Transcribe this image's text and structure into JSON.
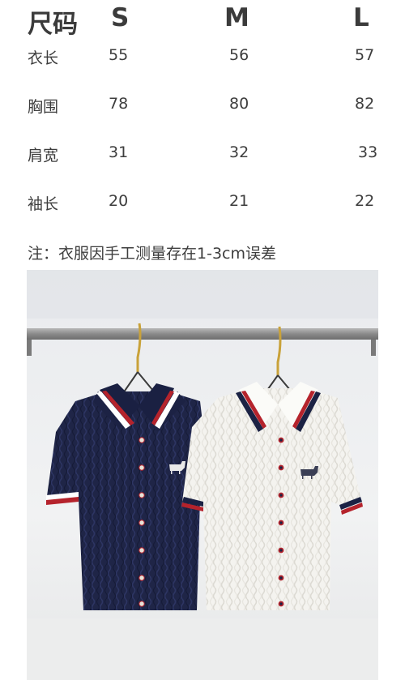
{
  "table": {
    "title": "尺码",
    "sizes": [
      "S",
      "M",
      "L"
    ],
    "rows": [
      {
        "label": "衣长",
        "values": [
          "55",
          "56",
          "57"
        ]
      },
      {
        "label": "胸围",
        "values": [
          "78",
          "80",
          "82"
        ]
      },
      {
        "label": "肩宽",
        "values": [
          "31",
          "32",
          "33"
        ]
      },
      {
        "label": "袖长",
        "values": [
          "20",
          "21",
          "22"
        ]
      }
    ]
  },
  "note": "注：衣服因手工测量存在1-3cm误差",
  "photo": {
    "items": [
      "navy-knit-polo-cardigan",
      "white-knit-polo-cardigan"
    ],
    "colors": {
      "navy": "#1f2547",
      "white": "#f4f3ef",
      "stripe_red": "#b5232c",
      "stripe_navy": "#1b2244",
      "rail": "#8c8c8c",
      "hanger": "#c9a23a"
    }
  }
}
